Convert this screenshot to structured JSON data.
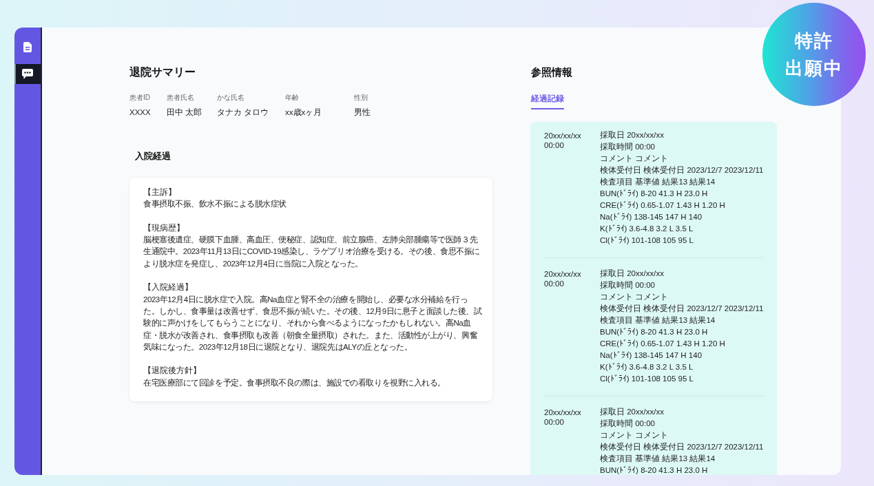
{
  "sidebar": {
    "items": [
      {
        "kind": "document",
        "selected": false
      },
      {
        "kind": "chat",
        "selected": true
      }
    ]
  },
  "summary": {
    "title": "退院サマリー",
    "patient_fields": [
      {
        "label": "患者ID",
        "value": "XXXX"
      },
      {
        "label": "患者氏名",
        "value": "田中 太郎"
      },
      {
        "label": "かな氏名",
        "value": "タナカ タロウ"
      },
      {
        "label": "年齢",
        "value": "xx歳xヶ月"
      },
      {
        "label": "性別",
        "value": "男性"
      }
    ],
    "course_heading": "入院経過",
    "sections": [
      {
        "heading": "【主訴】",
        "body": "食事摂取不振、飲水不振による脱水症状"
      },
      {
        "heading": "【現病歴】",
        "body": "脳梗塞後遺症、硬膜下血腫、高血圧、便秘症、認知症、前立腺癌、左肺尖部腫瘍等で医師３先生通院中。2023年11月13日にCOVID-19感染し、ラゲブリオ治療を受ける。その後、食思不振により脱水症を発症し、2023年12月4日に当院に入院となった。"
      },
      {
        "heading": "【入院経過】",
        "body": "2023年12月4日に脱水症で入院。高Na血症と腎不全の治療を開始し、必要な水分補給を行った。しかし、食事量は改善せず、食思不振が続いた。その後、12月9日に息子と面談した後、試験的に声かけをしてもらうことになり、それから食べるようになったかもしれない。高Na血症・脱水が改善され、食事摂取も改善（朝食全量摂取）された。また、活動性が上がり、興奮気味になった。2023年12月18日に退院となり、退院先はALYの丘となった。"
      },
      {
        "heading": "【退院後方針】",
        "body": "在宅医療部にて回診を予定。食事摂取不良の際は、施設での看取りを視野に入れる。"
      }
    ]
  },
  "reference": {
    "title": "参照情報",
    "tabs": [
      {
        "label": "経過記録",
        "selected": true
      }
    ],
    "records": [
      {
        "date": "20xx/xx/xx",
        "time": "00:00",
        "lines": [
          "採取日 20xx/xx/xx",
          "採取時間 00:00",
          "コメント コメント",
          "検体受付日 検体受付日 2023/12/7 2023/12/11",
          "検査項目 基準値 結果13 結果14",
          "BUN(ﾄﾞﾗｲ) 8-20 41.3 H 23.0 H",
          "CRE(ﾄﾞﾗｲ) 0.65-1.07 1.43 H 1.20 H",
          "Na(ﾄﾞﾗｲ) 138-145 147 H 140",
          "K(ﾄﾞﾗｲ) 3.6-4.8 3.2 L 3.5 L",
          "Cl(ﾄﾞﾗｲ) 101-108 105 95 L"
        ]
      },
      {
        "date": "20xx/xx/xx",
        "time": "00:00",
        "lines": [
          "採取日 20xx/xx/xx",
          "採取時間 00:00",
          "コメント コメント",
          "検体受付日 検体受付日 2023/12/7 2023/12/11",
          "検査項目 基準値 結果13 結果14",
          "BUN(ﾄﾞﾗｲ) 8-20 41.3 H 23.0 H",
          "CRE(ﾄﾞﾗｲ) 0.65-1.07 1.43 H 1.20 H",
          "Na(ﾄﾞﾗｲ) 138-145 147 H 140",
          "K(ﾄﾞﾗｲ) 3.6-4.8 3.2 L 3.5 L",
          "Cl(ﾄﾞﾗｲ) 101-108 105 95 L"
        ]
      },
      {
        "date": "20xx/xx/xx",
        "time": "00:00",
        "lines": [
          "採取日 20xx/xx/xx",
          "採取時間 00:00",
          "コメント コメント",
          "検体受付日 検体受付日 2023/12/7 2023/12/11",
          "検査項目 基準値 結果13 結果14",
          "BUN(ﾄﾞﾗｲ) 8-20 41.3 H 23.0 H"
        ]
      }
    ]
  },
  "badge": {
    "lines": [
      "特許",
      "出願中"
    ]
  }
}
